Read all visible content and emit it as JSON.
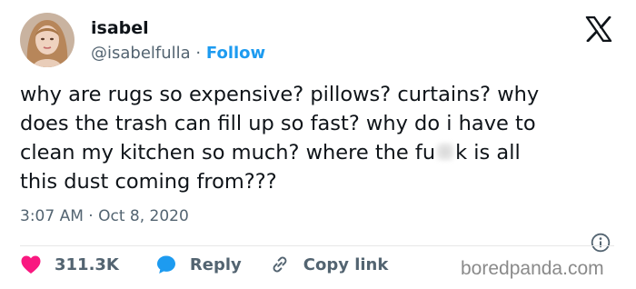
{
  "author": {
    "name": "isabel",
    "handle": "@isabelfulla",
    "separator": "·",
    "follow_label": "Follow",
    "avatar": "profile-photo"
  },
  "tweet": {
    "text_before": "why are rugs so expensive? pillows? curtains? why\ndoes the trash can fill up so fast? why do i have to\nclean my kitchen so much? where the fu",
    "text_after": "k is all\nthis dust coming from???",
    "timestamp": "3:07 AM · Oct 8, 2020"
  },
  "actions": {
    "like_count": "311.3K",
    "reply_label": "Reply",
    "copy_link_label": "Copy link"
  },
  "icons": {
    "logo": "x-logo-icon",
    "info": "info-icon",
    "like": "heart-icon",
    "reply": "reply-bubble-icon",
    "copy": "link-icon"
  },
  "colors": {
    "accent": "#1d9bf0",
    "like": "#f91880",
    "text": "#0f1419",
    "muted": "#536471"
  },
  "watermark": "boredpanda.com"
}
